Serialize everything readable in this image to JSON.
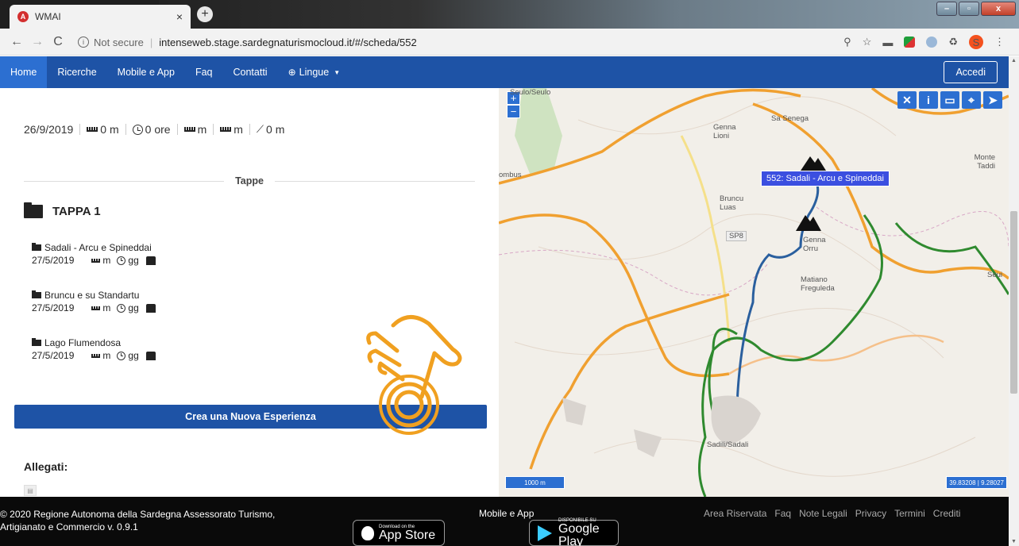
{
  "browser": {
    "tab_title": "WMAI",
    "tab_close": "×",
    "new_tab": "+",
    "back": "←",
    "forward": "→",
    "reload": "C",
    "not_secure": "Not secure",
    "url": "intenseweb.stage.sardegnaturismocloud.it/#/scheda/552",
    "avatar_letter": "S",
    "menu": "⋮"
  },
  "navbar": {
    "items": [
      "Home",
      "Ricerche",
      "Mobile e App",
      "Faq",
      "Contatti"
    ],
    "lingue": "Lingue",
    "accedi": "Accedi"
  },
  "stats": {
    "date": "26/9/2019",
    "length": "0 m",
    "duration": "0 ore",
    "ascent": "m",
    "descent": "m",
    "elevation": "0 m"
  },
  "tappe": {
    "title": "Tappe",
    "tappa_label": "TAPPA 1",
    "stages": [
      {
        "name": "Sadali - Arcu e Spineddai",
        "date": "27/5/2019",
        "dist": "m",
        "time": "gg"
      },
      {
        "name": "Bruncu e su Standartu",
        "date": "27/5/2019",
        "dist": "m",
        "time": "gg"
      },
      {
        "name": "Lago Flumendosa",
        "date": "27/5/2019",
        "dist": "m",
        "time": "gg"
      }
    ]
  },
  "crea_button": "Crea una Nuova Esperienza",
  "allegati": "Allegati:",
  "map": {
    "route_label": "552: Sadali - Arcu e Spineddai",
    "zoom_in": "+",
    "zoom_out": "−",
    "labels": {
      "seulo": "Seulo/Seulo",
      "genna_lioni": "Genna Lioni",
      "sa_senega": "Sa Senega",
      "monte_taddi": "Monte Taddi",
      "bruncu_luas": "Bruncu Luas",
      "sp8": "SP8",
      "genna_orru": "Genna Orru",
      "matiano": "Matiano Freguleda",
      "seui": "Seui",
      "sadali": "Sadili/Sadali",
      "ombus": "ombus"
    },
    "scale": "1000 m",
    "coords": "39.83208 | 9.28027"
  },
  "footer": {
    "copyright": "© 2020 Regione Autonoma della Sardegna Assessorato Turismo, Artigianato e Commercio v. 0.9.1",
    "mobile_app": "Mobile e App",
    "appstore_small": "Download on the",
    "appstore_big": "App Store",
    "gplay_small": "DISPONIBILE SU",
    "gplay_big": "Google Play",
    "links": [
      "Area Riservata",
      "Faq",
      "Note Legali",
      "Privacy",
      "Termini",
      "Crediti"
    ]
  },
  "colors": {
    "primary": "#1e53a6",
    "map_road": "#f0a030",
    "map_trail_blue": "#2a5f9e",
    "map_trail_green": "#2f8a2f"
  }
}
